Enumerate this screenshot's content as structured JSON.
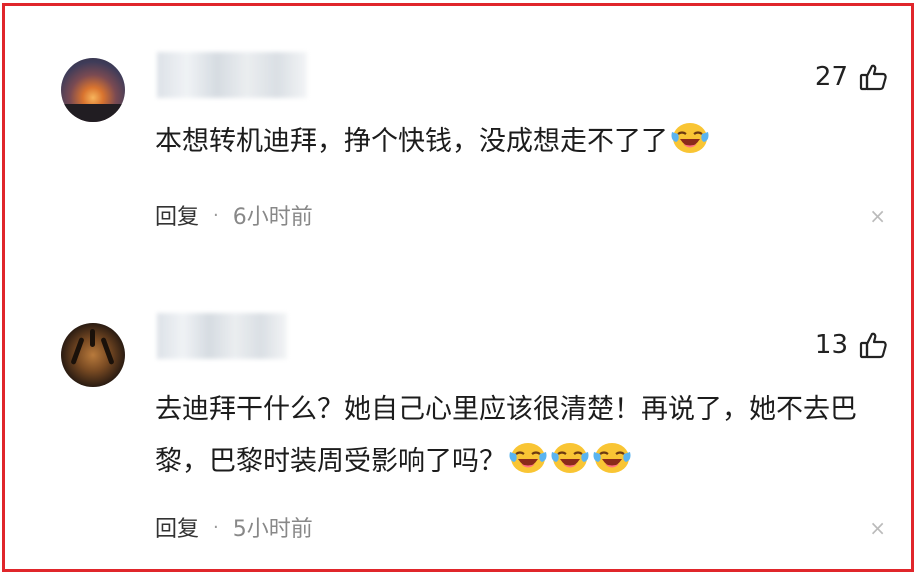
{
  "comments": [
    {
      "like_count": "27",
      "text": "本想转机迪拜，挣个快钱，没成想走不了了",
      "emoji_count": 1,
      "reply_label": "回复",
      "separator": "·",
      "time": "6小时前",
      "close_glyph": "×"
    },
    {
      "like_count": "13",
      "text": "去迪拜干什么？她自己心里应该很清楚！再说了，她不去巴黎，巴黎时装周受影响了吗？",
      "emoji_count": 3,
      "reply_label": "回复",
      "separator": "·",
      "time": "5小时前",
      "close_glyph": "×"
    }
  ],
  "icons": [
    "avatar-sunset",
    "avatar-tiger",
    "thumb-up-icon",
    "laughing-crying-emoji",
    "close-icon"
  ],
  "colors": {
    "frame": "#e0262b",
    "time_text": "#888888",
    "close": "#bbbbbb"
  }
}
